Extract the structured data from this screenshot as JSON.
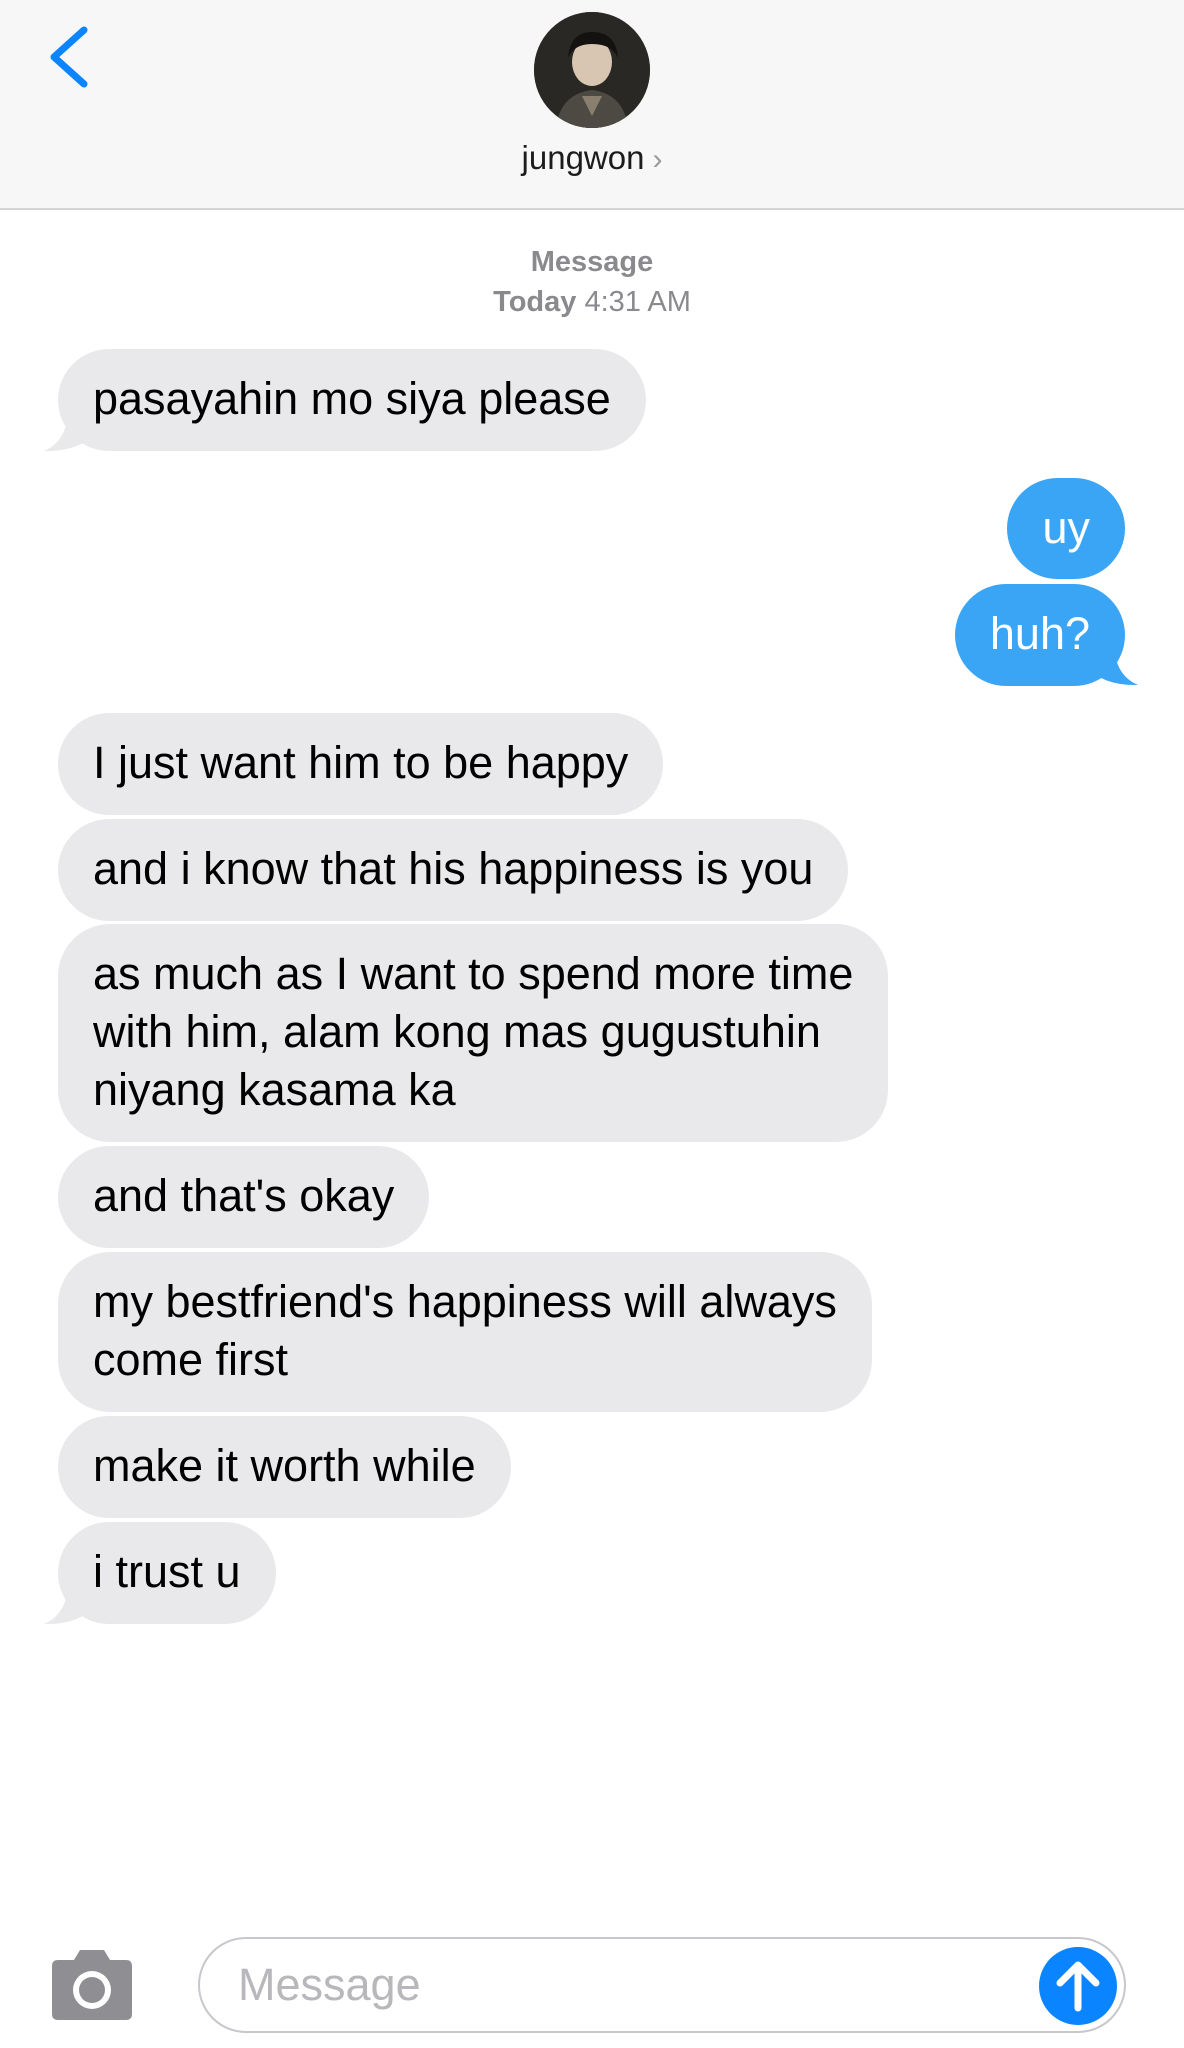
{
  "header": {
    "contact_name": "jungwon",
    "chevron": "›"
  },
  "thread": {
    "service_label": "Message",
    "day_label": "Today",
    "time_label": "4:31 AM"
  },
  "messages": [
    {
      "direction": "incoming",
      "text": "pasayahin mo siya please"
    },
    {
      "direction": "outgoing",
      "text": "uy"
    },
    {
      "direction": "outgoing",
      "text": "huh?"
    },
    {
      "direction": "incoming",
      "text": "I just want him to be happy"
    },
    {
      "direction": "incoming",
      "text": "and i know that his happiness is you"
    },
    {
      "direction": "incoming",
      "lines": [
        "as much as I want to spend more time",
        "with him, alam kong mas gugustuhin",
        "niyang kasama ka"
      ]
    },
    {
      "direction": "incoming",
      "text": "and that's okay"
    },
    {
      "direction": "incoming",
      "lines": [
        "my bestfriend's happiness will always",
        "come first"
      ]
    },
    {
      "direction": "incoming",
      "text": "make it worth while"
    },
    {
      "direction": "incoming",
      "text": "i trust u"
    }
  ],
  "composer": {
    "placeholder": "Message"
  },
  "icons": {
    "back": "chevron-left-icon",
    "camera": "camera-icon",
    "send": "arrow-up-icon"
  },
  "colors": {
    "accent": "#0a84ff",
    "outgoing_bubble": "#3aa4f5",
    "incoming_bubble": "#e9e9eb",
    "header_bg": "#f7f7f7"
  }
}
